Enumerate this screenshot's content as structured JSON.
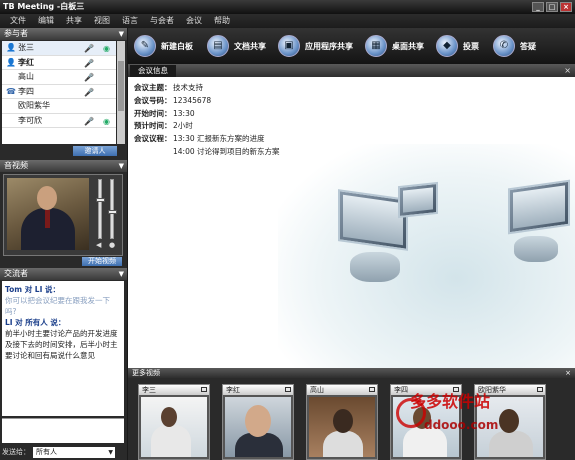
{
  "window": {
    "title": "TB Meeting -白板三",
    "min": "_",
    "max": "□",
    "close": "×"
  },
  "menu": [
    "文件",
    "编辑",
    "共享",
    "视图",
    "语言",
    "与会者",
    "会议",
    "帮助"
  ],
  "participants": {
    "header": "参与者",
    "rows": [
      {
        "name": "张三",
        "icon": "👤",
        "mic": "🎤",
        "cam": "◉"
      },
      {
        "name": "李红",
        "icon": "👤",
        "mic": "🎤",
        "cam": ""
      },
      {
        "name": "高山",
        "icon": "",
        "mic": "🎤",
        "cam": ""
      },
      {
        "name": "李四",
        "icon": "☎",
        "mic": "🎤",
        "cam": ""
      },
      {
        "name": "欧阳紫华",
        "icon": "",
        "mic": "",
        "cam": ""
      },
      {
        "name": "李可欣",
        "icon": "",
        "mic": "🎤",
        "cam": "◉"
      }
    ],
    "invite_label": "邀请人"
  },
  "video": {
    "header": "音视频",
    "button": "开始视频"
  },
  "chat": {
    "header": "交流者",
    "messages": [
      {
        "from": "Tom 对 LI 说：",
        "text": "你可以把会议纪要在跟我发一下吗?"
      },
      {
        "from": "LI 对 所有人 说：",
        "text": "前半小时主要讨论产品的开发进度及接下去的时间安排，后半小时主要讨论和回有局说什么意见"
      }
    ],
    "send_label": "发送给：",
    "send_target": "所有人"
  },
  "toolbar": [
    {
      "label": "新建白板",
      "icon": "whiteboard-icon",
      "glyph": "✎"
    },
    {
      "label": "文档共享",
      "icon": "document-share-icon",
      "glyph": "▤"
    },
    {
      "label": "应用程序共享",
      "icon": "app-share-icon",
      "glyph": "▣"
    },
    {
      "label": "桌面共享",
      "icon": "desktop-share-icon",
      "glyph": "▦"
    },
    {
      "label": "投票",
      "icon": "vote-icon",
      "glyph": "◆"
    },
    {
      "label": "答疑",
      "icon": "qa-icon",
      "glyph": "✆"
    }
  ],
  "meeting_info": {
    "tab": "会议信息",
    "close": "×",
    "rows": [
      {
        "k": "会议主题：",
        "v": "技术支持"
      },
      {
        "k": "会议号码：",
        "v": "12345678"
      },
      {
        "k": "开始时间：",
        "v": "13:30"
      },
      {
        "k": "预计时间：",
        "v": "2小时"
      },
      {
        "k": "会议议程：",
        "v": "13:30 汇报新东方案的进度"
      },
      {
        "k": "",
        "v": "14:00 讨论得到项目的新东方案"
      }
    ]
  },
  "more_video": {
    "header": "更多视频",
    "close": "×",
    "tiles": [
      {
        "name": "李三"
      },
      {
        "name": "李红"
      },
      {
        "name": "高山"
      },
      {
        "name": "李四"
      },
      {
        "name": "欧阳紫华"
      }
    ]
  },
  "watermark": {
    "line1": "多多软件站",
    "line2": "ddooo.com"
  }
}
